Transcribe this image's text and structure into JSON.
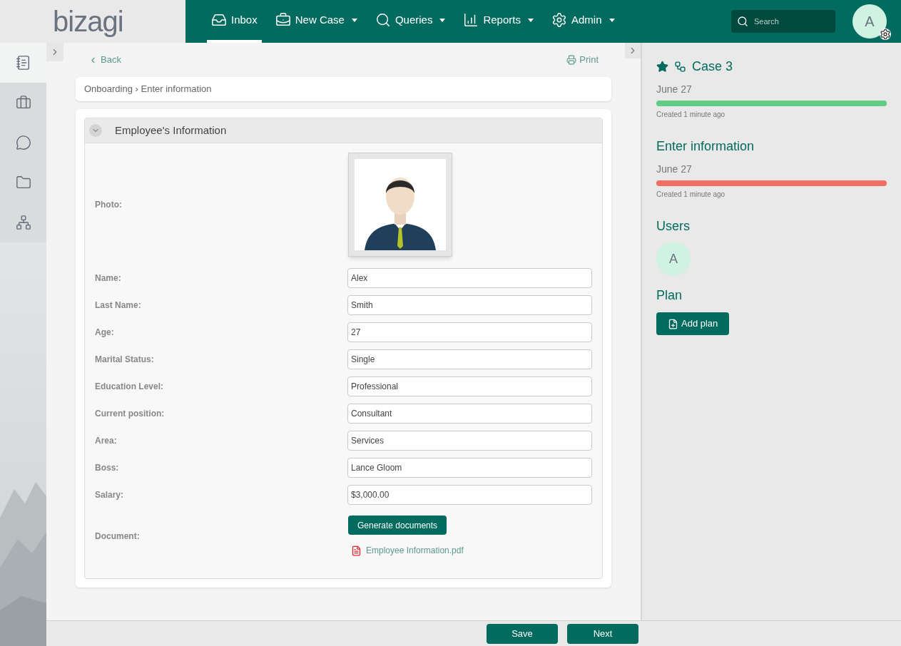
{
  "logo": "bizagi",
  "nav": [
    {
      "label": "Inbox",
      "dropdown": false,
      "selected": true
    },
    {
      "label": "New Case",
      "dropdown": true,
      "selected": false
    },
    {
      "label": "Queries",
      "dropdown": true,
      "selected": false
    },
    {
      "label": "Reports",
      "dropdown": true,
      "selected": false
    },
    {
      "label": "Admin",
      "dropdown": true,
      "selected": false
    }
  ],
  "search": {
    "placeholder": "Search"
  },
  "user_avatar": "A",
  "sidebar": {
    "items": [
      {
        "selected": true
      },
      {
        "selected": false
      },
      {
        "selected": false
      },
      {
        "selected": false
      },
      {
        "selected": false
      }
    ]
  },
  "back": "Back",
  "print": "Print",
  "breadcrumb": "Onboarding › Enter information",
  "form": {
    "title": "Employee's Information",
    "expanded": true,
    "photo_label": "Photo:",
    "fields": [
      {
        "label": "Name:",
        "value": "Alex"
      },
      {
        "label": "Last Name:",
        "value": "Smith"
      },
      {
        "label": "Age:",
        "value": "27"
      },
      {
        "label": "Marital Status:",
        "value": "Single"
      },
      {
        "label": "Education Level:",
        "value": "Professional"
      },
      {
        "label": "Current position:",
        "value": "Consultant"
      },
      {
        "label": "Area:",
        "value": "Services"
      },
      {
        "label": "Boss:",
        "value": "Lance Gloom"
      },
      {
        "label": "Salary:",
        "value": "$3,000.00"
      }
    ],
    "document_label": "Document:",
    "generate_button": "Generate documents",
    "file": "Employee Information.pdf"
  },
  "footer_buttons": [
    "Save",
    "Next"
  ],
  "case": {
    "title": "Case 3",
    "starred": true,
    "milestones": [
      {
        "date": "June 27",
        "level": 1,
        "color": "#62cc86",
        "created": "Created 1 minute ago"
      },
      {
        "title": "Enter information",
        "date": "June 27",
        "level": 1,
        "color": "#f36d64",
        "created": "Created 1 minute ago"
      }
    ],
    "users_title": "Users",
    "users": [
      "A"
    ],
    "plan_title": "Plan",
    "add_plan": "Add plan"
  }
}
